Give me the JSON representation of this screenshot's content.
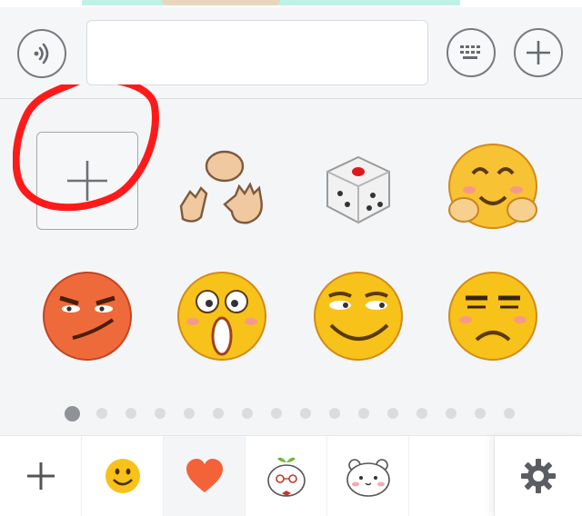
{
  "top_strip": {
    "icon": "chat-image-thumbnail"
  },
  "input_bar": {
    "voice_icon": "voice-icon",
    "message_value": "",
    "message_placeholder": "",
    "keyboard_icon": "keyboard-icon",
    "plus_icon": "plus-icon"
  },
  "sticker_grid": {
    "add_tile_icon": "plus-icon",
    "items": [
      {
        "name": "rock-paper-scissors",
        "icon": "rock-paper-scissors-hands"
      },
      {
        "name": "dice",
        "icon": "dice"
      },
      {
        "name": "shy-blush",
        "icon": "blushing-face"
      },
      {
        "name": "smirk-red",
        "icon": "angry-smirk-face"
      },
      {
        "name": "shocked",
        "icon": "shocked-face"
      },
      {
        "name": "sly-smile",
        "icon": "sly-smile-face"
      },
      {
        "name": "unamused",
        "icon": "unamused-face"
      }
    ],
    "annotation_color": "#ff1a1a"
  },
  "pagination": {
    "total_pages": 16,
    "current_page": 1
  },
  "bottom_tabs": [
    {
      "name": "add-sticker-pack",
      "icon": "plus-icon"
    },
    {
      "name": "emoji",
      "icon": "smiley-icon"
    },
    {
      "name": "favorites",
      "icon": "heart-icon",
      "selected": true
    },
    {
      "name": "sticker-pack-1",
      "icon": "sprout-character-icon"
    },
    {
      "name": "sticker-pack-2",
      "icon": "white-bear-icon"
    }
  ],
  "settings_icon": "gear-icon",
  "colors": {
    "accent_heart": "#f4623a",
    "emoji_yellow": "#f7c21a",
    "annotation_red": "#ff1a1a"
  }
}
